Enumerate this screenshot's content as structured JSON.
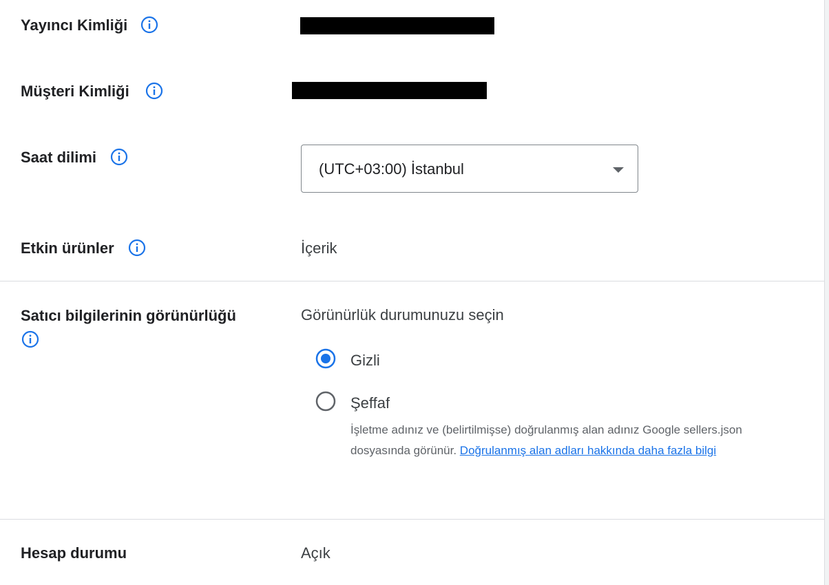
{
  "colors": {
    "accent": "#1a73e8",
    "text_primary": "#202124",
    "text_secondary": "#5f6368",
    "divider": "#dadce0",
    "redaction": "#000000"
  },
  "rows": {
    "publisher_id": {
      "label": "Yayıncı Kimliği",
      "icon": "info-icon",
      "value_redacted": true
    },
    "customer_id": {
      "label": "Müşteri Kimliği",
      "icon": "info-icon",
      "value_redacted": true
    },
    "time_zone": {
      "label": "Saat dilimi",
      "icon": "info-icon",
      "selected": "(UTC+03:00) İstanbul",
      "dropdown_icon": "dropdown-arrow-icon"
    },
    "active_products": {
      "label": "Etkin ürünler",
      "icon": "info-icon",
      "value": "İçerik"
    },
    "seller_visibility": {
      "label": "Satıcı bilgilerinin görünürlüğü",
      "icon": "info-icon",
      "prompt": "Görünürlük durumunuzu seçin",
      "options": [
        {
          "label": "Gizli",
          "selected": true
        },
        {
          "label": "Şeffaf",
          "selected": false
        }
      ],
      "description": "İşletme adınız ve (belirtilmişse) doğrulanmış alan adınız Google sellers.json dosyasında görünür.",
      "link_text": "Doğrulanmış alan adları hakkında daha fazla bilgi"
    },
    "account_status": {
      "label": "Hesap durumu",
      "value": "Açık"
    }
  }
}
